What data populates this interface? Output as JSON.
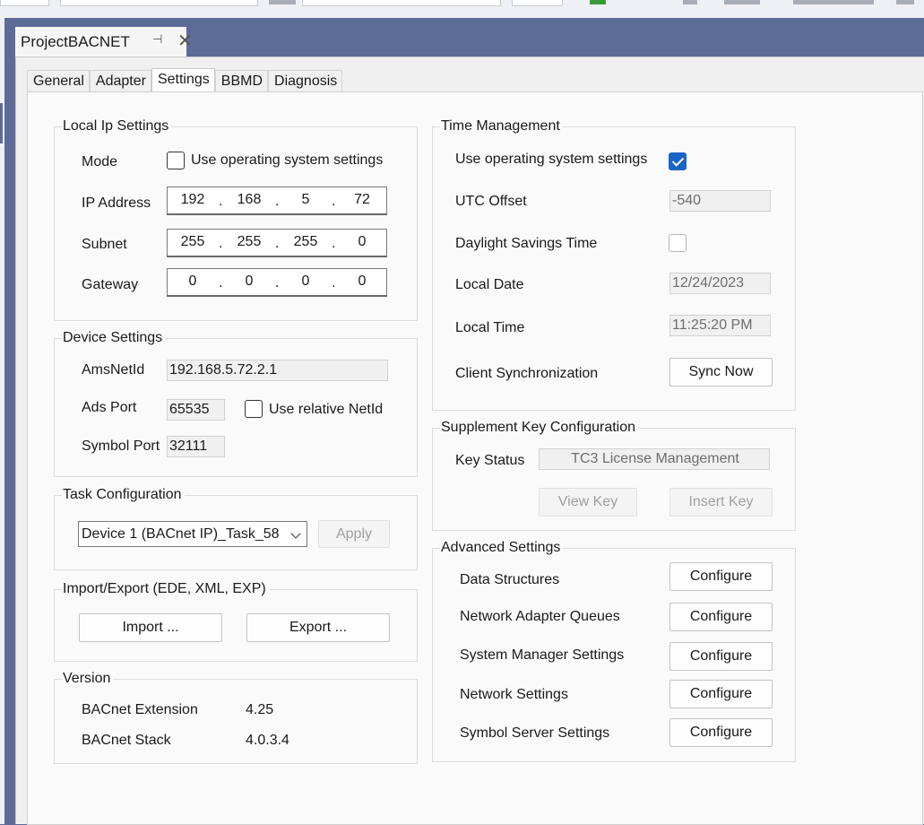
{
  "document": {
    "tab_title": "ProjectBACNET",
    "pin_glyph": "⊣",
    "close_glyph": "✕"
  },
  "tabs": [
    {
      "label": "General"
    },
    {
      "label": "Adapter"
    },
    {
      "label": "Settings",
      "active": true
    },
    {
      "label": "BBMD"
    },
    {
      "label": "Diagnosis"
    }
  ],
  "local_ip": {
    "title": "Local Ip Settings",
    "mode_label": "Mode",
    "use_os_label": "Use operating system settings",
    "use_os_checked": false,
    "ip_label": "IP Address",
    "ip": [
      "192",
      "168",
      "5",
      "72"
    ],
    "subnet_label": "Subnet",
    "subnet": [
      "255",
      "255",
      "255",
      "0"
    ],
    "gateway_label": "Gateway",
    "gateway": [
      "0",
      "0",
      "0",
      "0"
    ]
  },
  "device": {
    "title": "Device Settings",
    "amsnetid_label": "AmsNetId",
    "amsnetid": "192.168.5.72.2.1",
    "ads_port_label": "Ads Port",
    "ads_port": "65535",
    "relative_label": "Use relative NetId",
    "relative_checked": false,
    "symbol_port_label": "Symbol Port",
    "symbol_port": "32111"
  },
  "task": {
    "title": "Task Configuration",
    "selected": "Device 1 (BACnet IP)_Task_58",
    "apply_label": "Apply"
  },
  "import_export": {
    "title": "Import/Export (EDE, XML, EXP)",
    "import_label": "Import ...",
    "export_label": "Export ..."
  },
  "version": {
    "title": "Version",
    "ext_label": "BACnet Extension",
    "ext_value": "4.25",
    "stack_label": "BACnet Stack",
    "stack_value": "4.0.3.4"
  },
  "time": {
    "title": "Time Management",
    "use_os_label": "Use operating system settings",
    "use_os_checked": true,
    "utc_label": "UTC Offset",
    "utc_value": "-540",
    "dst_label": "Daylight Savings Time",
    "dst_checked": false,
    "date_label": "Local Date",
    "date_value": "12/24/2023",
    "time_label": "Local Time",
    "time_value": "11:25:20 PM",
    "sync_label": "Client Synchronization",
    "sync_button": "Sync Now"
  },
  "supplement": {
    "title": "Supplement Key Configuration",
    "status_label": "Key Status",
    "status_value": "TC3 License Management",
    "view_label": "View Key",
    "insert_label": "Insert Key"
  },
  "advanced": {
    "title": "Advanced Settings",
    "button_label": "Configure",
    "rows": [
      "Data Structures",
      "Network Adapter Queues",
      "System Manager Settings",
      "Network Settings",
      "Symbol Server Settings"
    ]
  }
}
